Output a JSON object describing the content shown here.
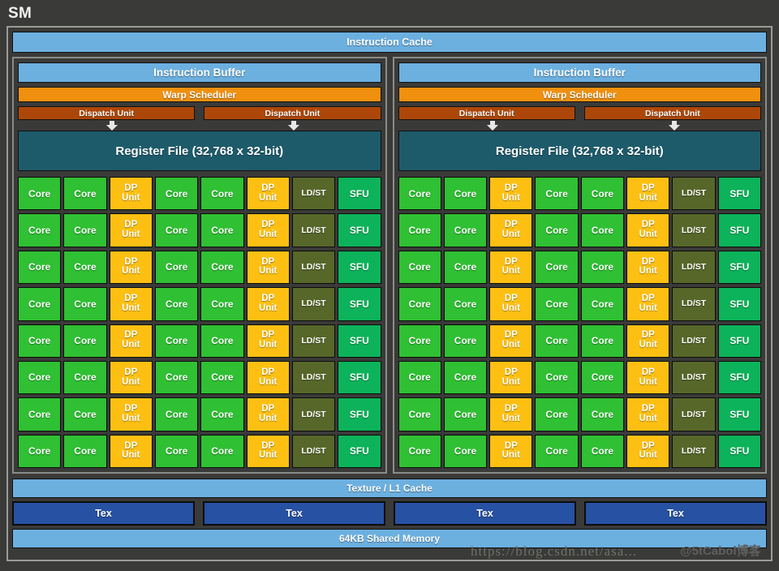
{
  "title": "SM",
  "instruction_cache": "Instruction Cache",
  "partitions": [
    {
      "instruction_buffer": "Instruction Buffer",
      "warp_scheduler": "Warp Scheduler",
      "dispatch_units": [
        "Dispatch Unit",
        "Dispatch Unit"
      ],
      "register_file": "Register File (32,768 x 32-bit)"
    },
    {
      "instruction_buffer": "Instruction Buffer",
      "warp_scheduler": "Warp Scheduler",
      "dispatch_units": [
        "Dispatch Unit",
        "Dispatch Unit"
      ],
      "register_file": "Register File (32,768 x 32-bit)"
    }
  ],
  "unit_labels": {
    "core": "Core",
    "dp_line1": "DP",
    "dp_line2": "Unit",
    "ldst": "LD/ST",
    "sfu": "SFU"
  },
  "grid": {
    "rows": 8,
    "columns": [
      "core",
      "core",
      "dp",
      "core",
      "core",
      "dp",
      "ldst",
      "sfu"
    ]
  },
  "texture_l1_cache": "Texture / L1 Cache",
  "tex_units": [
    "Tex",
    "Tex",
    "Tex",
    "Tex"
  ],
  "shared_memory": "64KB Shared Memory",
  "watermark": "https://blog.csdn.net/asa...",
  "watermark_logo": "@5tCabol博客",
  "colors": {
    "background": "#3a3a38",
    "light_blue": "#6cb0e0",
    "orange": "#f0900f",
    "dark_orange": "#ad4709",
    "teal": "#1d5b6b",
    "navy": "#2751a3",
    "core_green": "#2fc033",
    "dp_yellow": "#fdc012",
    "ldst_olive": "#57672a",
    "sfu_green": "#0cb35a",
    "frame_border": "#9a9a97"
  }
}
